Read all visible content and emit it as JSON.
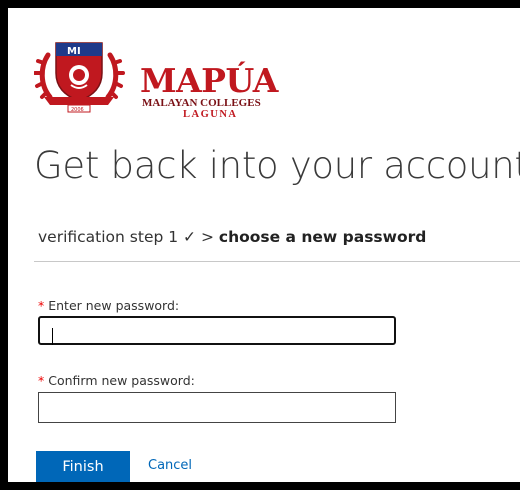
{
  "logo": {
    "name": "MAPÚA",
    "subtitle": "MALAYAN COLLEGES",
    "campus": "LAGUNA",
    "seal_year": "2006"
  },
  "page": {
    "title": "Get back into your account"
  },
  "steps": {
    "done": "verification step 1 ✓",
    "separator": " > ",
    "current": "choose a new password"
  },
  "form": {
    "required_marker": "*",
    "new_password_label": "Enter new password:",
    "new_password_value": "",
    "confirm_password_label": "Confirm new password:",
    "confirm_password_value": ""
  },
  "actions": {
    "finish_label": "Finish",
    "cancel_label": "Cancel"
  },
  "colors": {
    "brand_red": "#c0181f",
    "accent_blue": "#0067b8",
    "required_red": "#ee0000"
  }
}
